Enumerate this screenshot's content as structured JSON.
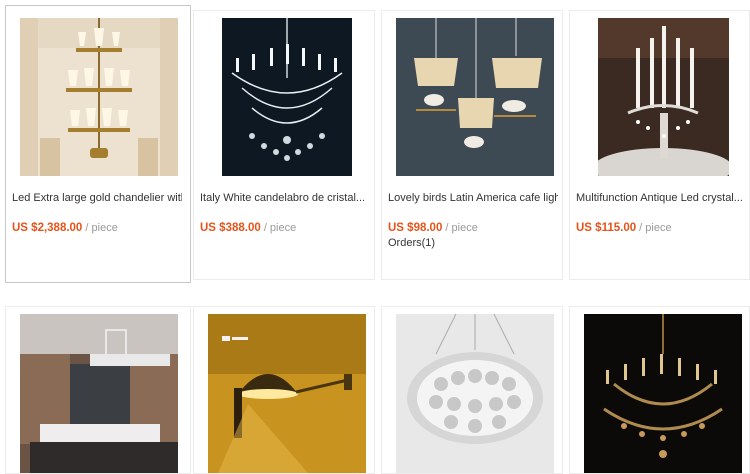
{
  "products": [
    {
      "title": "Led Extra large gold chandelier with...",
      "price": "US $2,388.00",
      "unit": "/ piece",
      "image": "gold-chandelier-photo"
    },
    {
      "title": "Italy White candelabro de cristal...",
      "price": "US $388.00",
      "unit": "/ piece",
      "image": "crystal-chandelier-photo"
    },
    {
      "title": "Lovely birds Latin America cafe light...",
      "price": "US $98.00",
      "unit": "/ piece",
      "orders": "Orders(1)",
      "image": "bird-pendant-lights-photo"
    },
    {
      "title": "Multifunction Antique Led crystal...",
      "price": "US $115.00",
      "unit": "/ piece",
      "image": "candelabra-photo"
    },
    {
      "image": "dining-room-light-photo"
    },
    {
      "image": "wall-lamp-photo"
    },
    {
      "image": "round-crystal-pendant-photo"
    },
    {
      "image": "gold-crystal-chandelier-photo"
    }
  ],
  "colors": {
    "price": "#e5531a",
    "unit": "#999999",
    "border": "#ececec"
  }
}
